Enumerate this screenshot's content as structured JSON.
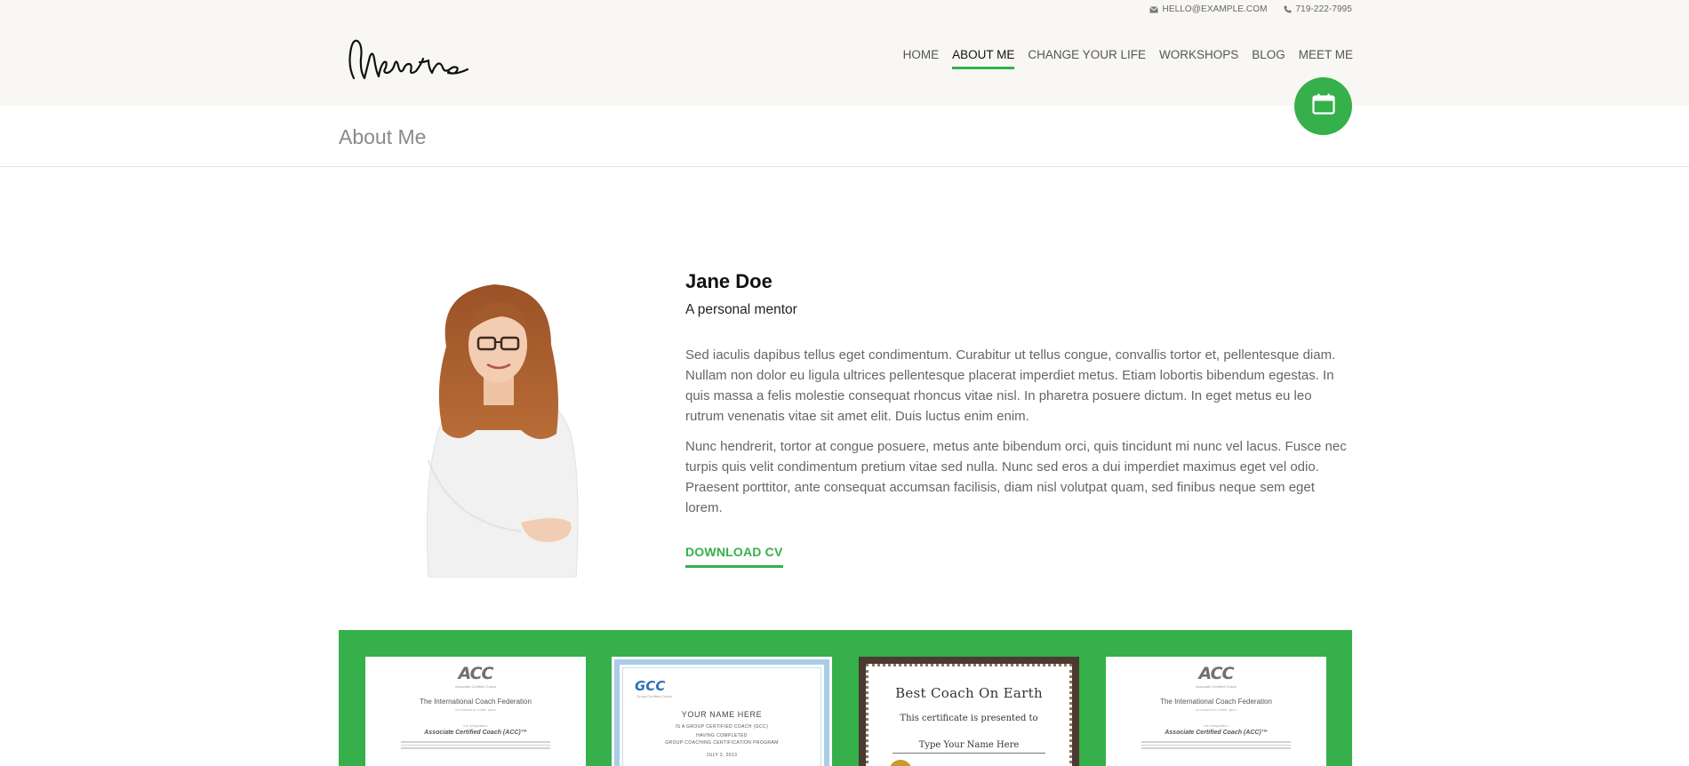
{
  "header": {
    "email": "HELLO@EXAMPLE.COM",
    "phone": "719-222-7995",
    "logo_text": "mentor",
    "nav": [
      {
        "label": "HOME",
        "active": false
      },
      {
        "label": "ABOUT ME",
        "active": true
      },
      {
        "label": "CHANGE YOUR LIFE",
        "active": false
      },
      {
        "label": "WORKSHOPS",
        "active": false
      },
      {
        "label": "BLOG",
        "active": false
      },
      {
        "label": "MEET ME",
        "active": false
      }
    ],
    "fab_icon": "calendar-icon"
  },
  "page": {
    "title": "About Me"
  },
  "profile": {
    "name": "Jane Doe",
    "subtitle": "A personal mentor",
    "paragraphs": [
      "Sed iaculis dapibus tellus eget condimentum. Curabitur ut tellus congue, convallis tortor et, pellentesque diam. Nullam non dolor eu ligula ultrices pellentesque placerat imperdiet metus. Etiam lobortis bibendum egestas. In quis massa a felis molestie consequat rhoncus vitae nisl. In pharetra posuere dictum. In eget metus eu leo rutrum venenatis vitae sit amet elit. Duis luctus enim enim.",
      "Nunc hendrerit, tortor at congue posuere, metus ante bibendum orci, quis tincidunt mi nunc vel lacus. Fusce nec turpis quis velit condimentum pretium vitae sed nulla. Nunc sed eros a dui imperdiet maximus eget vel odio. Praesent porttitor, ante consequat accumsan facilisis, diam nisl volutpat quam, sed finibus neque sem eget lorem."
    ],
    "cv_label": "DOWNLOAD CV"
  },
  "certificates": {
    "acc": {
      "logo": "ACC",
      "logo_sub": "Associate Certified Coach",
      "org": "The International Coach Federation",
      "org_sub": "is honored to confer upon",
      "designation_lead": "the designation",
      "title": "Associate Certified Coach (ACC)™"
    },
    "gcc": {
      "logo": "GCC",
      "logo_sub": "Group Certified Coach",
      "name": "YOUR NAME HERE",
      "line1": "IS A GROUP CERTIFIED COACH (GCC)",
      "line2": "HAVING COMPLETED",
      "line3": "GROUP COACHING CERTIFICATION PROGRAM",
      "date": "JULY 2, 2013"
    },
    "best": {
      "title": "Best Coach On Earth",
      "subtitle": "This certificate is presented to",
      "name": "Type Your Name Here"
    }
  },
  "colors": {
    "accent": "#35b04a",
    "header_bg": "#f8f7f4"
  }
}
